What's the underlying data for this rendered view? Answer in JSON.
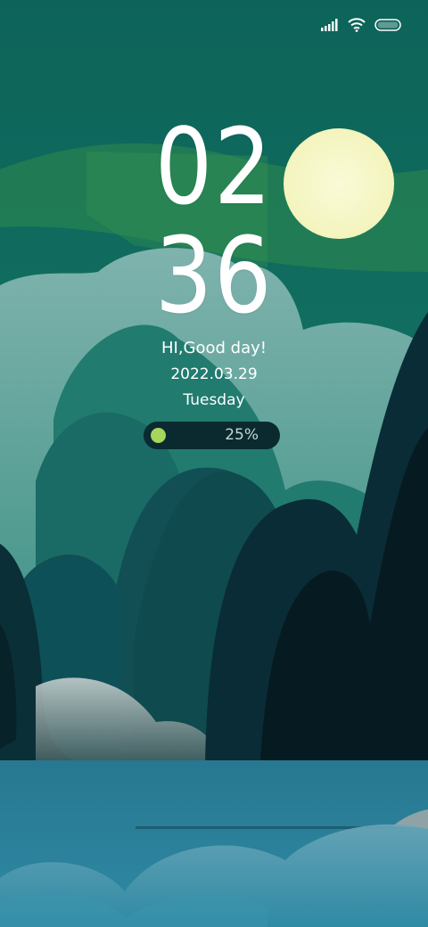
{
  "status_bar": {
    "signal_icon": "signal-bars-icon",
    "wifi_icon": "wifi-icon",
    "battery_icon": "battery-icon"
  },
  "clock": {
    "hours": "02",
    "minutes": "36"
  },
  "greeting": "HI,Good day!",
  "date": "2022.03.29",
  "weekday": "Tuesday",
  "battery": {
    "percent_label": "25%",
    "level": 0.25,
    "dot_color": "#a6d65b"
  },
  "colors": {
    "sky": "#0f6a5e",
    "moon": "#f7f8c8",
    "water": "#2a7d98"
  }
}
